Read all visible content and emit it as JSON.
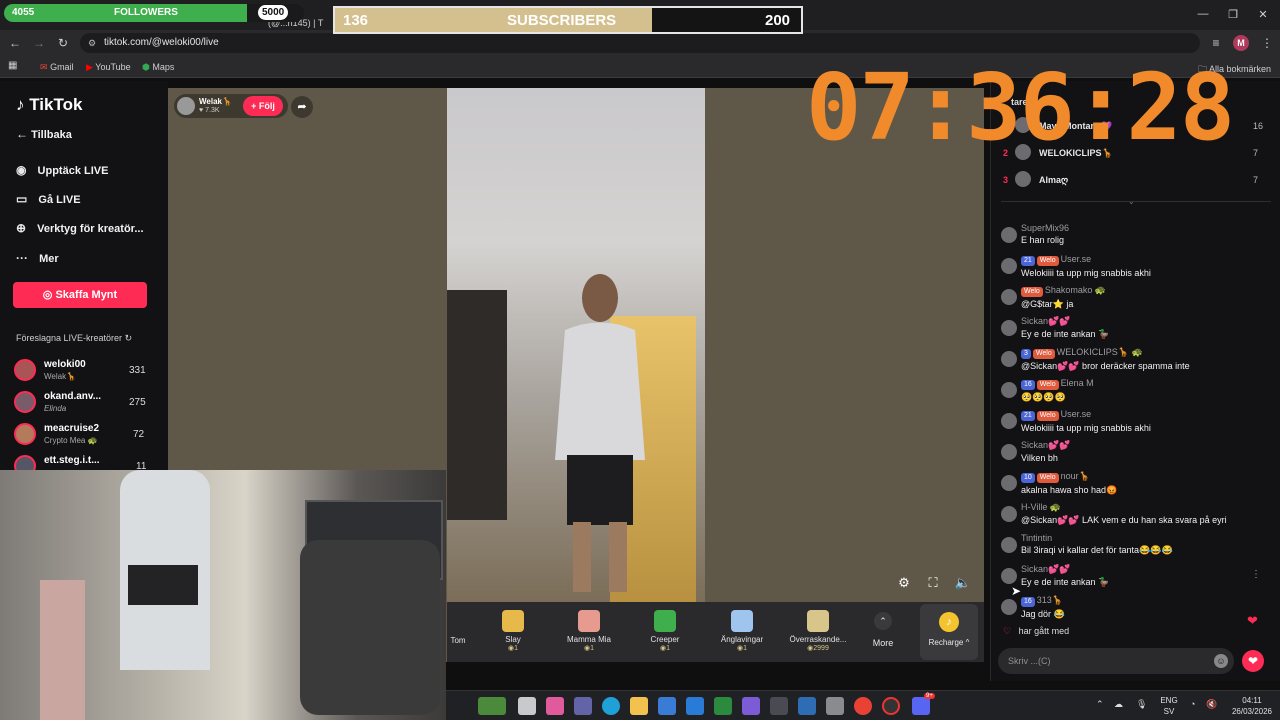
{
  "overlays": {
    "followers": {
      "current": "4055",
      "label": "FOLLOWERS",
      "goal": "5000",
      "progress": 0.81
    },
    "subscribers": {
      "current": "136",
      "label": "SUBSCRIBERS",
      "goal": "200",
      "progress": 0.68
    },
    "timer": "07:36:28"
  },
  "browser": {
    "tab_text": "...com (@...n145) | T",
    "url": "tiktok.com/@weloki00/live",
    "bookmarks": [
      "Gmail",
      "YouTube",
      "Maps"
    ],
    "all_bookmarks": "Alla bokmärken",
    "profile_initial": "M"
  },
  "sidebar": {
    "logo": "TikTok",
    "back": "Tillbaka",
    "nav": [
      {
        "label": "Upptäck LIVE",
        "icon": "live-icon"
      },
      {
        "label": "Gå LIVE",
        "icon": "camera-icon"
      },
      {
        "label": "Verktyg för kreatör...",
        "icon": "tools-icon"
      },
      {
        "label": "Mer",
        "icon": "more-icon"
      }
    ],
    "coins_button": "Skaffa Mynt",
    "suggested_title": "Föreslagna LIVE-kreatörer",
    "creators": [
      {
        "name": "weloki00",
        "sub": "Welak🦒",
        "count": "331"
      },
      {
        "name": "okand.anv...",
        "sub": "Elinda",
        "count": "275"
      },
      {
        "name": "meacruise2",
        "sub": "Crypto Mea 🐢",
        "count": "72"
      },
      {
        "name": "ett.steg.i.t...",
        "sub": "",
        "count": "11"
      }
    ]
  },
  "stream": {
    "host_name": "Welak🦒",
    "host_likes": "♥ 7.3K",
    "follow_label": "+ Följ"
  },
  "gifts": [
    {
      "name": "Tom",
      "price": ""
    },
    {
      "name": "Slay",
      "price": "1",
      "color": "#e7b84a"
    },
    {
      "name": "Mamma Mia",
      "price": "1",
      "color": "#e79a8e"
    },
    {
      "name": "Creeper",
      "price": "1",
      "color": "#3fae4c"
    },
    {
      "name": "Änglavingar",
      "price": "1",
      "color": "#9fc4ee"
    },
    {
      "name": "Överraskande...",
      "price": "2999",
      "color": "#d7c58a"
    }
  ],
  "gift_more": "More",
  "recharge": "Recharge ^",
  "chat": {
    "header": "tare",
    "ranking": [
      {
        "rank": "1",
        "name": "Maya Montana💜",
        "score": "16"
      },
      {
        "rank": "2",
        "name": "WELOKICLIPS🦒",
        "score": "7"
      },
      {
        "rank": "3",
        "name": "Almaღ",
        "score": "7"
      }
    ],
    "messages": [
      {
        "user": "SuperMix96",
        "badges": [],
        "text": "E han rolig"
      },
      {
        "user": "User.se",
        "badges": [
          "21",
          "Welo"
        ],
        "text": "Welokiiii ta upp mig snabbis akhi"
      },
      {
        "user": "Shakomako 🐢",
        "badges": [
          "Welo"
        ],
        "text": "@G$tar⭐ ja"
      },
      {
        "user": "Sickan💕💕",
        "badges": [],
        "text": "Ey e de inte ankan 🦆"
      },
      {
        "user": "WELOKICLIPS🦒 🐢",
        "badges": [
          "3",
          "Welo"
        ],
        "text": "@Sickan💕💕 bror deräcker spamma inte"
      },
      {
        "user": "Elena M",
        "badges": [
          "16",
          "Welo"
        ],
        "text": "🥺🥺🥺🥺"
      },
      {
        "user": "User.se",
        "badges": [
          "21",
          "Welo"
        ],
        "text": "Welokiiii ta upp mig snabbis akhi"
      },
      {
        "user": "Sickan💕💕",
        "badges": [],
        "text": "Vilken bh"
      },
      {
        "user": "nour🦒",
        "badges": [
          "10",
          "Welo"
        ],
        "text": "akalna hawa sho had😡"
      },
      {
        "user": "H-Ville 🐢",
        "badges": [],
        "text": "@Sickan💕💕 LAK vem e du han ska svara på eyri"
      },
      {
        "user": "Tintintin",
        "badges": [],
        "text": "Bil 3iraqi vi kallar det för tanta😂😂😂"
      },
      {
        "user": "Sickan💕💕",
        "badges": [],
        "text": "Ey e de inte ankan 🦆"
      },
      {
        "user": "313🦒",
        "badges": [
          "16"
        ],
        "text": "Jag dör 😂"
      }
    ],
    "joined": "har gått med",
    "input_placeholder": "Skriv ...(C)"
  },
  "taskbar": {
    "lang": "ENG",
    "lang2": "SV",
    "time": "04:11",
    "date": "26/03/2026",
    "discord_badge": "9+"
  }
}
